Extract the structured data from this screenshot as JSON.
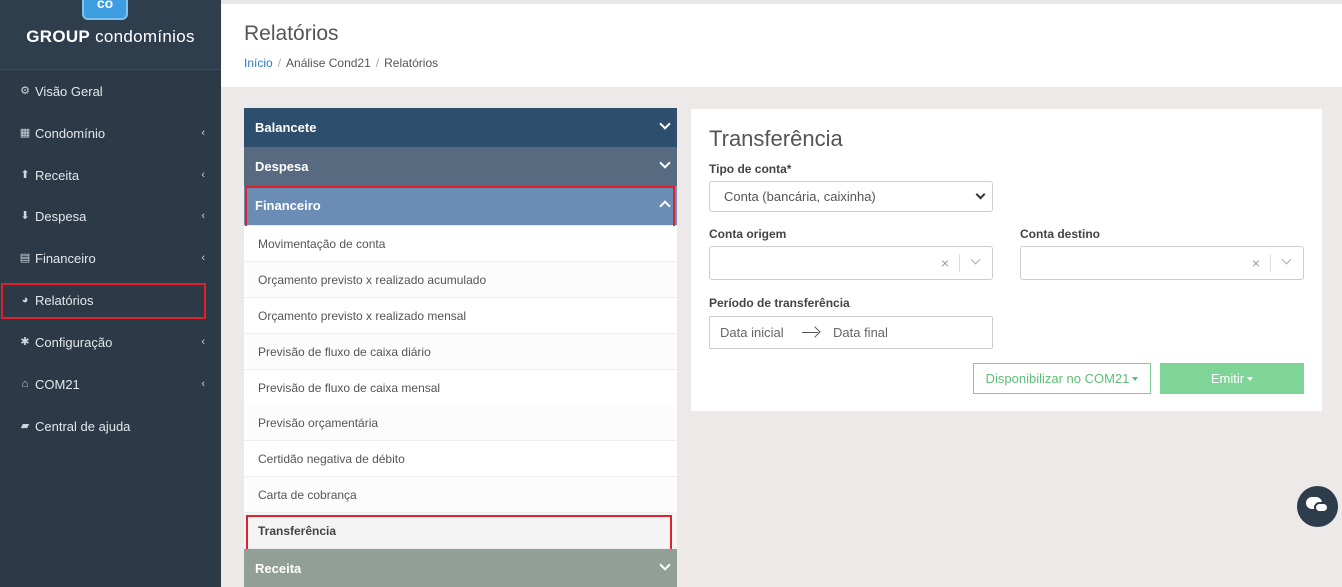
{
  "brand": {
    "logo": "co",
    "name_bold": "GROUP",
    "name_rest": " condomínios"
  },
  "sidebar": {
    "items": [
      {
        "label": "Visão Geral",
        "icon": "dashboard-icon",
        "glyph": "⚙",
        "has_chevron": false
      },
      {
        "label": "Condomínio",
        "icon": "building-icon",
        "glyph": "▦",
        "has_chevron": true
      },
      {
        "label": "Receita",
        "icon": "arrow-up-circle-icon",
        "glyph": "⬆",
        "has_chevron": true
      },
      {
        "label": "Despesa",
        "icon": "arrow-down-circle-icon",
        "glyph": "⬇",
        "has_chevron": true
      },
      {
        "label": "Financeiro",
        "icon": "calculator-icon",
        "glyph": "▤",
        "has_chevron": true
      },
      {
        "label": "Relatórios",
        "icon": "pie-chart-icon",
        "glyph": "◕",
        "has_chevron": false
      },
      {
        "label": "Configuração",
        "icon": "gear-icon",
        "glyph": "✱",
        "has_chevron": true
      },
      {
        "label": "COM21",
        "icon": "home-icon",
        "glyph": "⌂",
        "has_chevron": true
      },
      {
        "label": "Central de ajuda",
        "icon": "help-book-icon",
        "glyph": "▰",
        "has_chevron": false
      }
    ],
    "chevron": "‹",
    "highlighted_item": "Relatórios"
  },
  "header": {
    "title": "Relatórios",
    "breadcrumb": [
      "Início",
      "Análise Cond21",
      "Relatórios"
    ],
    "breadcrumb_sep": "/"
  },
  "accordion": {
    "sections": [
      {
        "label": "Balancete",
        "color": "#2e4e6d"
      },
      {
        "label": "Despesa",
        "color": "#576a80"
      },
      {
        "label": "Financeiro",
        "color": "#6b8cb5"
      },
      {
        "label": "Receita",
        "color": "#919f96"
      }
    ],
    "financeiro_items": [
      "Movimentação de conta",
      "Orçamento previsto x realizado acumulado",
      "Orçamento previsto x realizado mensal",
      "Previsão de fluxo de caixa diário",
      "Previsão de fluxo de caixa mensal",
      "Previsão orçamentária",
      "Certidão negativa de débito",
      "Carta de cobrança",
      "Transferência"
    ]
  },
  "form": {
    "title": "Transferência",
    "tipo_conta_label": "Tipo de conta*",
    "tipo_conta_value": "Conta (bancária, caixinha)",
    "conta_origem_label": "Conta origem",
    "conta_destino_label": "Conta destino",
    "clear_glyph": "×",
    "periodo_label": "Período de transferência",
    "data_inicial_placeholder": "Data inicial",
    "data_final_placeholder": "Data final",
    "disponibilizar_label": "Disponibilizar no COM21",
    "emitir_label": "Emitir"
  },
  "colors": {
    "highlight": "#e0202b",
    "success": "#7fd597",
    "sidebar": "#2c3a47"
  }
}
